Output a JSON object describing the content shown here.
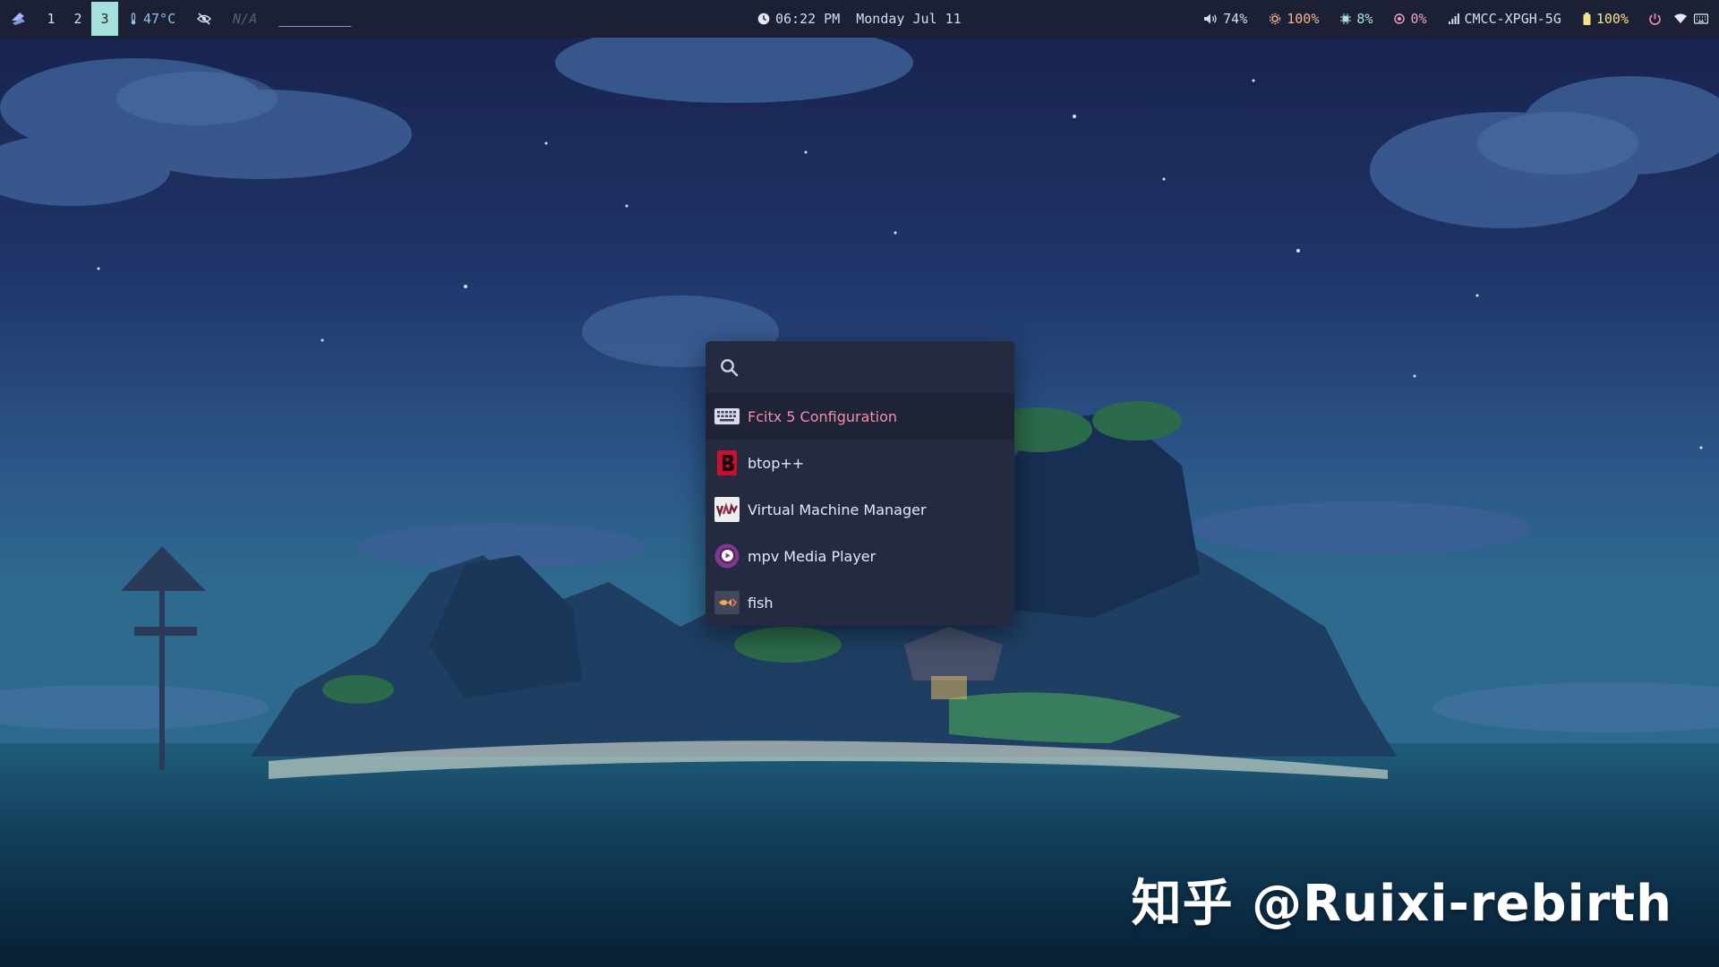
{
  "taskbar": {
    "workspaces": [
      {
        "label": "1",
        "active": false
      },
      {
        "label": "2",
        "active": false
      },
      {
        "label": "3",
        "active": true
      }
    ],
    "temperature": "47°C",
    "media_status": "N/A",
    "cava_bars": "__________",
    "time": "06:22 PM",
    "date": "Monday Jul 11",
    "volume": "74%",
    "brightness": "100%",
    "cpu": "8%",
    "memory": "0%",
    "network_name": "CMCC-XPGH-5G",
    "battery": "100%"
  },
  "launcher": {
    "search_placeholder": "",
    "results": [
      {
        "label": "Fcitx 5 Configuration",
        "icon": "keyboard-icon",
        "selected": true
      },
      {
        "label": "btop++",
        "icon": "btop-icon",
        "selected": false
      },
      {
        "label": "Virtual Machine Manager",
        "icon": "virt-manager-icon",
        "selected": false
      },
      {
        "label": "mpv Media Player",
        "icon": "mpv-icon",
        "selected": false
      },
      {
        "label": "fish",
        "icon": "fish-terminal-icon",
        "selected": false
      }
    ]
  },
  "watermark": "知乎 @Ruixi-rebirth",
  "colors": {
    "bar_bg": "#1c2035",
    "launcher_bg": "#242a40",
    "selected_text": "#f28fad",
    "active_workspace": "#a5e0dc"
  }
}
